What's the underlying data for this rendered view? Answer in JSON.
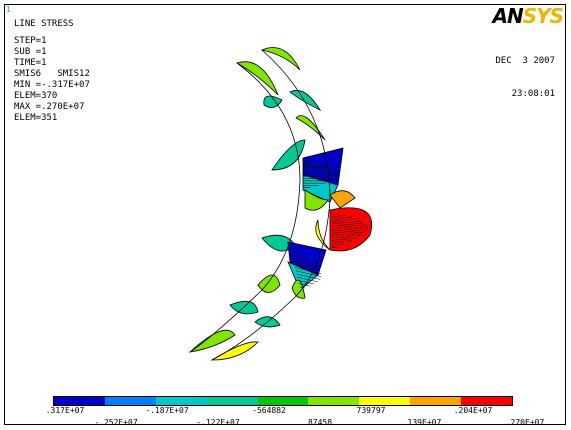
{
  "window_number": "1",
  "plot_info": {
    "title": "LINE STRESS",
    "step": "STEP=1",
    "sub": "SUB =1",
    "time": "TIME=1",
    "items": "SMIS6   SMIS12",
    "min": "MIN =-.317E+07",
    "min_elem": "ELEM=370",
    "max": "MAX =.270E+07",
    "max_elem": "ELEM=351"
  },
  "date": "DEC  3 2007",
  "time_of_day": "23:08:01",
  "logo": {
    "part1": "AN",
    "part2": "SYS"
  },
  "legend": {
    "colors": [
      "#0000c8",
      "#0080ff",
      "#00c8c8",
      "#00c896",
      "#00c800",
      "#80e600",
      "#ffff00",
      "#ffa500",
      "#ff0000"
    ],
    "labels_top": [
      ".317E+07",
      "-.187E+07",
      "-564882",
      "739797",
      ".204E+07"
    ],
    "labels_bottom": [
      "-.252E+07",
      "-.122E+07",
      "87458",
      ".139E+07",
      ".270E+07"
    ]
  },
  "colors": {
    "outline": "#000000",
    "blue": "#0000c8",
    "light_blue": "#0080ff",
    "cyan": "#00c8c8",
    "teal": "#00c896",
    "green": "#00c800",
    "yellow_green": "#80e600",
    "yellow": "#ffff00",
    "orange": "#ffa500",
    "red": "#ff0000",
    "dark_red": "#b00000"
  }
}
